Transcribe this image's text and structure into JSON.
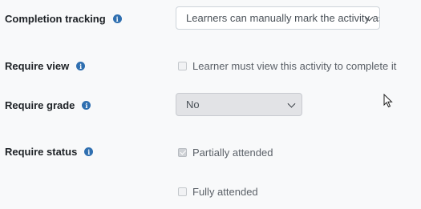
{
  "completion_tracking": {
    "label": "Completion tracking",
    "value": "Learners can manually mark the activity as completed"
  },
  "require_view": {
    "label": "Require view",
    "option": {
      "text": "Learner must view this activity to complete it",
      "checked": false,
      "disabled": true
    }
  },
  "require_grade": {
    "label": "Require grade",
    "value": "No",
    "disabled": true
  },
  "require_status": {
    "label": "Require status",
    "options": [
      {
        "text": "Partially attended",
        "checked": true,
        "disabled": true
      },
      {
        "text": "Fully attended",
        "checked": false,
        "disabled": true
      }
    ]
  },
  "icons": {
    "help": "info-icon",
    "dropdown": "chevron-down-icon",
    "pointer": "mouse-cursor-icon"
  },
  "colors": {
    "info_icon": "#2f6fb0",
    "page_background": "#f8f9fa",
    "disabled_select": "#e2e3e6"
  }
}
